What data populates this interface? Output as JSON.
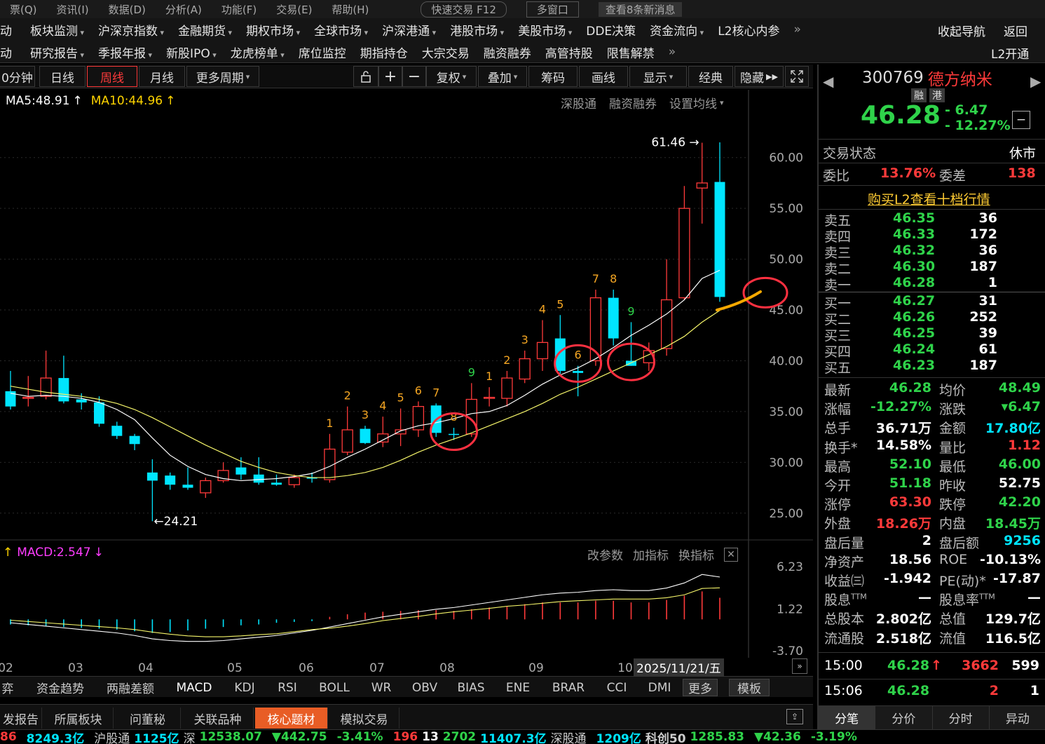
{
  "menubar": {
    "items": [
      "票(Q)",
      "资讯(I)",
      "数据(D)",
      "分析(A)",
      "功能(F)",
      "交易(E)",
      "帮助(H)",
      "快速交易 F12",
      "多窗口",
      "查看8条新消息"
    ]
  },
  "nav": {
    "row1": [
      {
        "t": "动",
        "dd": false
      },
      {
        "t": "板块监测",
        "dd": true
      },
      {
        "t": "沪深京指数",
        "dd": true
      },
      {
        "t": "金融期货",
        "dd": true
      },
      {
        "t": "期权市场",
        "dd": true
      },
      {
        "t": "全球市场",
        "dd": true
      },
      {
        "t": "沪深港通",
        "dd": true
      },
      {
        "t": "港股市场",
        "dd": true
      },
      {
        "t": "美股市场",
        "dd": true
      },
      {
        "t": "DDE决策",
        "dd": false
      },
      {
        "t": "资金流向",
        "dd": true
      },
      {
        "t": "L2核心内参",
        "dd": false
      }
    ],
    "row2": [
      {
        "t": "动",
        "dd": false
      },
      {
        "t": "研究报告",
        "dd": true
      },
      {
        "t": "季报年报",
        "dd": true
      },
      {
        "t": "新股IPO",
        "dd": true
      },
      {
        "t": "龙虎榜单",
        "dd": true
      },
      {
        "t": "席位监控",
        "dd": false
      },
      {
        "t": "期指持仓",
        "dd": false
      },
      {
        "t": "大宗交易",
        "dd": false
      },
      {
        "t": "融资融券",
        "dd": false
      },
      {
        "t": "高管持股",
        "dd": false
      },
      {
        "t": "限售解禁",
        "dd": false
      }
    ],
    "collapse": "收起导航",
    "back": "返回",
    "l2": "L2开通"
  },
  "toolbar": {
    "period_partial": "0分钟",
    "daily": "日线",
    "weekly": "周线",
    "monthly": "月线",
    "more": "更多周期",
    "fuquan": "复权",
    "diejia": "叠加",
    "chouma": "筹码",
    "huaxian": "画线",
    "xianshi": "显示",
    "jingdian": "经典",
    "yincang": "隐藏"
  },
  "ma": {
    "ma5": "MA5:48.91",
    "ma10": "MA10:44.96",
    "links": [
      "深股通",
      "融资融券",
      "设置均线"
    ]
  },
  "macd": {
    "label": "MACD:2.547",
    "links": [
      "改参数",
      "加指标",
      "换指标"
    ],
    "ticks": [
      "6.23",
      "1.22",
      "-3.70"
    ]
  },
  "chart_data": {
    "type": "candlestick",
    "yticks": [
      "60.00",
      "55.00",
      "50.00",
      "45.00",
      "40.00",
      "35.00",
      "30.00",
      "25.00"
    ],
    "ylim": [
      22.5,
      63.5
    ],
    "xlabels": [
      "02",
      "03",
      "04",
      "05",
      "06",
      "07",
      "08",
      "09",
      "10"
    ],
    "date_label": "2025/11/21/五",
    "annotations": {
      "high": "61.46",
      "low": "24.21"
    },
    "candles": [
      {
        "o": 37.0,
        "h": 39.0,
        "l": 35.2,
        "c": 35.5
      },
      {
        "o": 36.3,
        "h": 38.5,
        "l": 35.5,
        "c": 36.4
      },
      {
        "o": 36.5,
        "h": 41.0,
        "l": 36.2,
        "c": 38.3
      },
      {
        "o": 38.3,
        "h": 40.5,
        "l": 35.8,
        "c": 36.0
      },
      {
        "o": 36.2,
        "h": 36.8,
        "l": 35.2,
        "c": 35.9
      },
      {
        "o": 35.9,
        "h": 36.5,
        "l": 33.5,
        "c": 33.8
      },
      {
        "o": 33.6,
        "h": 34.0,
        "l": 32.3,
        "c": 32.6
      },
      {
        "o": 32.6,
        "h": 32.8,
        "l": 31.2,
        "c": 31.8
      },
      {
        "o": 29.0,
        "h": 30.3,
        "l": 24.21,
        "c": 28.2
      },
      {
        "o": 28.7,
        "h": 29.0,
        "l": 27.3,
        "c": 27.8
      },
      {
        "o": 27.8,
        "h": 29.5,
        "l": 27.3,
        "c": 27.5
      },
      {
        "o": 27.0,
        "h": 28.5,
        "l": 26.5,
        "c": 28.2
      },
      {
        "o": 28.2,
        "h": 30.0,
        "l": 28.0,
        "c": 29.2
      },
      {
        "o": 29.5,
        "h": 30.5,
        "l": 28.3,
        "c": 28.8
      },
      {
        "o": 28.8,
        "h": 30.5,
        "l": 27.8,
        "c": 28.0
      },
      {
        "o": 28.0,
        "h": 28.8,
        "l": 27.7,
        "c": 27.8
      },
      {
        "o": 27.8,
        "h": 28.8,
        "l": 27.5,
        "c": 28.5
      },
      {
        "o": 28.5,
        "h": 29.0,
        "l": 28.0,
        "c": 28.4
      },
      {
        "o": 28.3,
        "h": 32.8,
        "l": 28.0,
        "c": 31.3
      },
      {
        "o": 31.0,
        "h": 35.5,
        "l": 30.7,
        "c": 33.2
      },
      {
        "o": 33.3,
        "h": 33.6,
        "l": 31.8,
        "c": 31.9
      },
      {
        "o": 32.0,
        "h": 34.5,
        "l": 31.5,
        "c": 32.8
      },
      {
        "o": 32.8,
        "h": 35.3,
        "l": 31.6,
        "c": 33.2
      },
      {
        "o": 33.2,
        "h": 36.0,
        "l": 32.5,
        "c": 35.5
      },
      {
        "o": 35.6,
        "h": 35.8,
        "l": 32.5,
        "c": 32.9
      },
      {
        "o": 32.8,
        "h": 33.4,
        "l": 32.2,
        "c": 32.7
      },
      {
        "o": 32.8,
        "h": 37.8,
        "l": 32.5,
        "c": 36.2
      },
      {
        "o": 36.3,
        "h": 37.4,
        "l": 35.5,
        "c": 36.4
      },
      {
        "o": 36.3,
        "h": 39.0,
        "l": 35.5,
        "c": 38.3
      },
      {
        "o": 38.2,
        "h": 41.0,
        "l": 37.8,
        "c": 40.2
      },
      {
        "o": 40.2,
        "h": 44.0,
        "l": 39.0,
        "c": 41.8
      },
      {
        "o": 42.2,
        "h": 44.5,
        "l": 38.5,
        "c": 39.0
      },
      {
        "o": 39.0,
        "h": 39.5,
        "l": 36.5,
        "c": 38.8
      },
      {
        "o": 40.0,
        "h": 47.0,
        "l": 39.5,
        "c": 46.2
      },
      {
        "o": 46.2,
        "h": 47.0,
        "l": 41.5,
        "c": 42.2
      },
      {
        "o": 40.0,
        "h": 43.8,
        "l": 39.5,
        "c": 39.5
      },
      {
        "o": 39.8,
        "h": 41.8,
        "l": 39.0,
        "c": 41.0
      },
      {
        "o": 41.2,
        "h": 50.0,
        "l": 40.5,
        "c": 46.0
      },
      {
        "o": 46.2,
        "h": 57.2,
        "l": 46.0,
        "c": 55.0
      },
      {
        "o": 57.0,
        "h": 61.46,
        "l": 53.5,
        "c": 57.5
      },
      {
        "o": 57.6,
        "h": 61.5,
        "l": 45.8,
        "c": 46.28
      }
    ],
    "ma5": [
      36.8,
      36.5,
      36.6,
      36.5,
      36.3,
      35.9,
      35.2,
      34.2,
      32.4,
      30.7,
      29.6,
      28.8,
      28.4,
      28.2,
      28.3,
      28.4,
      28.6,
      28.9,
      29.6,
      30.5,
      31.3,
      32.2,
      33.1,
      33.6,
      33.9,
      34.3,
      34.8,
      35.0,
      35.6,
      36.6,
      37.7,
      38.6,
      39.3,
      40.2,
      41.3,
      42.5,
      43.5,
      44.6,
      46.0,
      48.1,
      48.91
    ],
    "ma10": [
      37.5,
      37.2,
      36.9,
      36.7,
      36.5,
      36.2,
      35.8,
      35.2,
      34.4,
      33.5,
      32.6,
      31.7,
      30.9,
      30.1,
      29.5,
      29.0,
      28.7,
      28.5,
      28.5,
      28.7,
      29.0,
      29.5,
      30.2,
      31.0,
      31.7,
      32.3,
      32.9,
      33.6,
      34.3,
      35.0,
      35.8,
      36.7,
      37.4,
      38.2,
      39.0,
      39.8,
      40.6,
      41.4,
      42.4,
      43.8,
      44.96
    ],
    "tdnum": [
      null,
      null,
      null,
      null,
      null,
      null,
      null,
      null,
      null,
      null,
      null,
      null,
      null,
      null,
      null,
      null,
      null,
      null,
      "1",
      "2",
      "3",
      "4",
      "5",
      "6",
      "7",
      "8",
      "9",
      "1",
      "2",
      "3",
      "4",
      "5",
      "6",
      "7",
      "8",
      "9",
      null,
      null,
      null,
      null,
      null
    ],
    "macd_hist": [
      -0.6,
      -0.7,
      -0.8,
      -0.9,
      -1.0,
      -1.1,
      -1.2,
      -1.4,
      -1.6,
      -1.5,
      -1.3,
      -1.1,
      -0.9,
      -0.7,
      -0.6,
      -0.4,
      -0.3,
      -0.2,
      0.3,
      0.6,
      0.8,
      0.9,
      1.0,
      1.1,
      1.1,
      1.0,
      1.2,
      1.4,
      1.5,
      1.8,
      2.0,
      2.0,
      2.0,
      2.2,
      2.2,
      2.0,
      2.0,
      2.3,
      2.8,
      3.3,
      2.55
    ],
    "macd_dif": [
      -0.4,
      -0.6,
      -0.8,
      -1.0,
      -1.2,
      -1.4,
      -1.6,
      -1.9,
      -2.3,
      -2.5,
      -2.6,
      -2.6,
      -2.5,
      -2.3,
      -2.1,
      -1.9,
      -1.6,
      -1.3,
      -0.9,
      -0.5,
      -0.1,
      0.3,
      0.6,
      0.9,
      1.2,
      1.4,
      1.7,
      2.0,
      2.3,
      2.6,
      2.9,
      3.1,
      3.2,
      3.4,
      3.5,
      3.4,
      3.4,
      3.7,
      4.3,
      5.3,
      5.0
    ]
  },
  "stock": {
    "code": "300769",
    "name": "德方纳米",
    "tag1": "融",
    "tag2": "港",
    "price": "46.28",
    "chg": "- 6.47",
    "pct": "- 12.27%"
  },
  "status": {
    "label": "交易状态",
    "value": "休市",
    "weibi_l": "委比",
    "weibi": "13.76%",
    "weicha_l": "委差",
    "weicha": "138",
    "l2link": "购买L2查看十档行情"
  },
  "asks": [
    {
      "l": "卖五",
      "p": "46.35",
      "v": "36"
    },
    {
      "l": "卖四",
      "p": "46.33",
      "v": "172"
    },
    {
      "l": "卖三",
      "p": "46.32",
      "v": "36"
    },
    {
      "l": "卖二",
      "p": "46.30",
      "v": "187"
    },
    {
      "l": "卖一",
      "p": "46.28",
      "v": "1"
    }
  ],
  "bids": [
    {
      "l": "买一",
      "p": "46.27",
      "v": "31"
    },
    {
      "l": "买二",
      "p": "46.26",
      "v": "252"
    },
    {
      "l": "买三",
      "p": "46.25",
      "v": "39"
    },
    {
      "l": "买四",
      "p": "46.24",
      "v": "61"
    },
    {
      "l": "买五",
      "p": "46.23",
      "v": "187"
    }
  ],
  "quote": [
    [
      {
        "l": "最新",
        "v": "46.28",
        "c": "grn"
      },
      {
        "l": "均价",
        "v": "48.49",
        "c": "grn"
      }
    ],
    [
      {
        "l": "涨幅",
        "v": "-12.27%",
        "c": "grn"
      },
      {
        "l": "涨跌",
        "v": "▾6.47",
        "c": "grn"
      }
    ],
    [
      {
        "l": "总手",
        "v": "36.71万",
        "c": "wht"
      },
      {
        "l": "金额",
        "v": "17.80亿",
        "c": "cyan"
      }
    ],
    [
      {
        "l": "换手*",
        "v": "14.58%",
        "c": "wht"
      },
      {
        "l": "量比",
        "v": "1.12",
        "c": "red"
      }
    ],
    [
      {
        "l": "最高",
        "v": "52.10",
        "c": "grn"
      },
      {
        "l": "最低",
        "v": "46.00",
        "c": "grn"
      }
    ],
    [
      {
        "l": "今开",
        "v": "51.18",
        "c": "grn"
      },
      {
        "l": "昨收",
        "v": "52.75",
        "c": "wht"
      }
    ],
    [
      {
        "l": "涨停",
        "v": "63.30",
        "c": "red"
      },
      {
        "l": "跌停",
        "v": "42.20",
        "c": "grn"
      }
    ],
    [
      {
        "l": "外盘",
        "v": "18.26万",
        "c": "red"
      },
      {
        "l": "内盘",
        "v": "18.45万",
        "c": "grn"
      }
    ],
    [
      {
        "l": "盘后量",
        "v": "2",
        "c": "wht"
      },
      {
        "l": "盘后额",
        "v": "9256",
        "c": "cyan"
      }
    ],
    [
      {
        "l": "净资产",
        "v": "18.56",
        "c": "wht"
      },
      {
        "l": "ROE",
        "v": "-10.13%",
        "c": "wht"
      }
    ],
    [
      {
        "l": "收益㈢",
        "v": "-1.942",
        "c": "wht"
      },
      {
        "l": "PE(动)*",
        "v": "-17.87",
        "c": "wht"
      }
    ],
    [
      {
        "l": "股息TTM",
        "v": "—",
        "c": "wht"
      },
      {
        "l": "股息率TTM",
        "v": "—",
        "c": "wht"
      }
    ],
    [
      {
        "l": "总股本",
        "v": "2.802亿",
        "c": "wht"
      },
      {
        "l": "总值",
        "v": "129.7亿",
        "c": "wht"
      }
    ],
    [
      {
        "l": "流通股",
        "v": "2.518亿",
        "c": "wht"
      },
      {
        "l": "流值",
        "v": "116.5亿",
        "c": "wht"
      }
    ]
  ],
  "ticks": [
    {
      "t": "15:00",
      "p": "46.28",
      "arrow": "↑",
      "v": "3662",
      "n": "599"
    },
    {
      "t": "15:06",
      "p": "46.28",
      "arrow": "",
      "v": "2",
      "n": "1"
    }
  ],
  "rtabs": [
    "分笔",
    "分价",
    "分时",
    "异动"
  ],
  "indicators": [
    "弈",
    "资金趋势",
    "两融差额",
    "MACD",
    "KDJ",
    "RSI",
    "BOLL",
    "WR",
    "OBV",
    "BIAS",
    "ENE",
    "BRAR",
    "CCI",
    "DMI",
    "更多",
    "模板"
  ],
  "btabs": [
    "发报告",
    "所属板块",
    "问董秘",
    "关联品种",
    "核心题材",
    "模拟交易"
  ],
  "statusbar": [
    "86",
    "8249.3亿",
    "沪股通",
    "1125亿",
    "深",
    "12538.07",
    "▼442.75",
    "-3.41%",
    "196",
    "13",
    "2702",
    "11407.3亿",
    "深股通",
    "1209亿",
    "科创50",
    "1285.83",
    "▼42.36",
    "-3.19%"
  ],
  "colors": {
    "up": "#ff3a3a",
    "down": "#00e5ff",
    "ma5": "#ffffff",
    "ma10": "#f5f56a",
    "accent": "#e85d25",
    "circle": "#ff3040"
  }
}
